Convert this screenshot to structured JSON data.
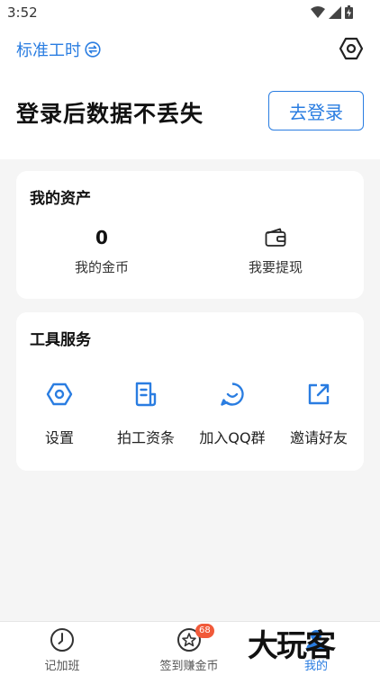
{
  "status_bar": {
    "time": "3:52"
  },
  "header": {
    "standard_hours_label": "标准工时"
  },
  "login": {
    "prompt": "登录后数据不丢失",
    "button_label": "去登录"
  },
  "assets": {
    "title": "我的资产",
    "coins_value": "0",
    "coins_label": "我的金币",
    "withdraw_label": "我要提现"
  },
  "tools": {
    "title": "工具服务",
    "items": [
      {
        "label": "设置",
        "icon": "settings-hex-icon"
      },
      {
        "label": "拍工资条",
        "icon": "document-icon"
      },
      {
        "label": "加入QQ群",
        "icon": "smile-chat-icon"
      },
      {
        "label": "邀请好友",
        "icon": "share-icon"
      }
    ]
  },
  "tabbar": {
    "items": [
      {
        "label": "记加班",
        "icon": "clock-icon"
      },
      {
        "label": "签到赚金币",
        "icon": "star-icon",
        "badge": "68"
      },
      {
        "label": "我的",
        "icon": "user-icon"
      }
    ]
  },
  "watermark": {
    "text": "大玩客"
  },
  "colors": {
    "accent": "#2a7de1",
    "badge": "#f15a3a",
    "background": "#f5f5f5"
  }
}
